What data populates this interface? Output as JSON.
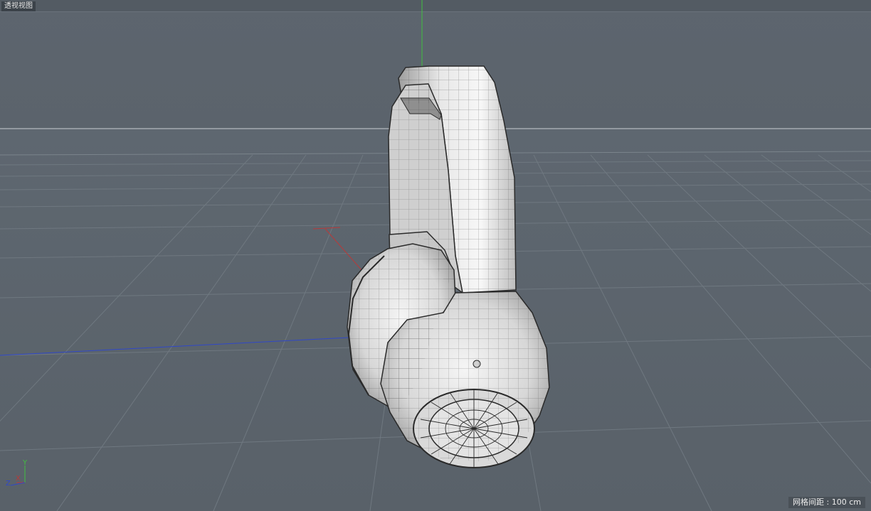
{
  "viewport": {
    "title": "透视视图",
    "grid_spacing": "网格间距 : 100 cm"
  },
  "axes": {
    "x": "X",
    "y": "Y",
    "z": "Z"
  },
  "colors": {
    "background": "#5a636c",
    "grid": "#6f7880",
    "x_axis": "#b83a3a",
    "y_axis": "#40c040",
    "z_axis": "#3048c8",
    "model_fill": "#d8d8d8",
    "model_wire": "#2a2a2a"
  },
  "icons": {
    "axis_gizmo": "xyz-axis-icon"
  }
}
